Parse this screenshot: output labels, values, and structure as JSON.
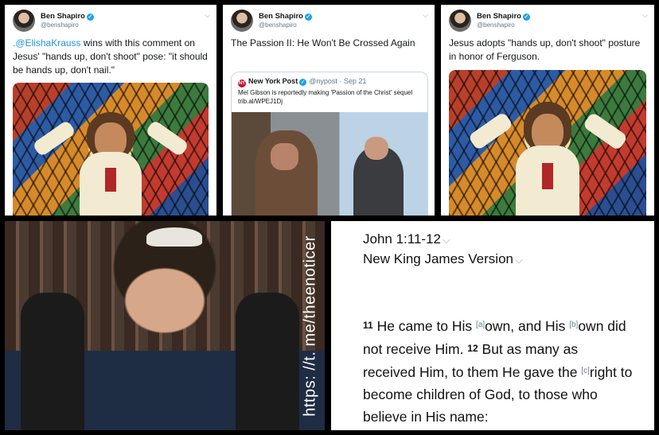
{
  "tweet1": {
    "name": "Ben Shapiro",
    "handle": "@benshapiro",
    "mention": ".@ElishaKrauss",
    "text": " wins with this comment on Jesus' \"hands up, don't shoot\" pose: \"it should be hands up, don't nail.\""
  },
  "tweet2": {
    "name": "Ben Shapiro",
    "handle": "@benshapiro",
    "text": "The Passion II: He Won't Be Crossed Again",
    "quoted": {
      "logo": "NY",
      "name": "New York Post",
      "handle": "@nypost · Sep 21",
      "text": "Mel Gibson is reportedly making 'Passion of the Christ' sequel trib.al/WPEJ1Dj"
    }
  },
  "tweet3": {
    "name": "Ben Shapiro",
    "handle": "@benshapiro",
    "text": "Jesus adopts \"hands up, don't shoot\" posture in honor of Ferguson."
  },
  "photo": {
    "watermark": "https: //t. me/theenoticer"
  },
  "bible": {
    "reference": "John 1:11-12",
    "version": "New King James Version",
    "v11": "11",
    "t1": "He came to His ",
    "fa": "[a]",
    "t2": "own, and His ",
    "fb": "[b]",
    "t3": "own did not receive Him. ",
    "v12": "12",
    "t4": "But as many as received Him, to them He gave the ",
    "fc": "[c]",
    "t5": "right to become children of God, to those who believe in His name:"
  },
  "icons": {
    "verified": "verified-badge-icon",
    "chevron": "chevron-down-icon"
  },
  "colors": {
    "link": "#1b95e0",
    "verified": "#1da1f2",
    "nypost": "#c8102e"
  }
}
